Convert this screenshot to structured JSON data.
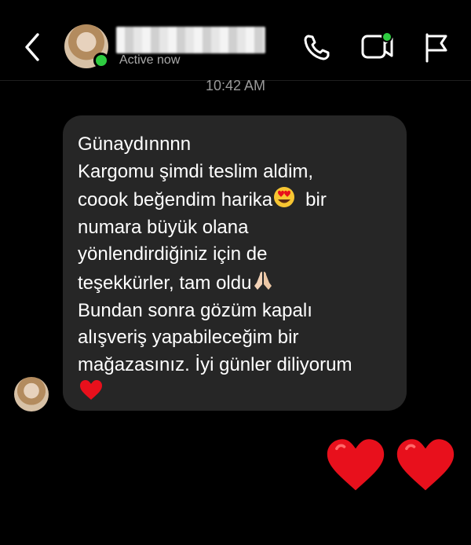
{
  "header": {
    "status": "Active now",
    "icons": [
      "back-chevron-icon",
      "phone-icon",
      "video-icon",
      "flag-icon"
    ]
  },
  "timestamp": "10:42 AM",
  "message": {
    "lines": [
      "Günaydınnnn",
      "Kargomu şimdi teslim aldim,",
      "coook beğendim harika",
      "bir",
      "numara büyük olana",
      "yönlendirdiğiniz için de",
      "teşekkürler, tam oldu",
      "Bundan sonra gözüm kapalı",
      "alışveriş yapabileceğim bir",
      "mağazasınız. İyi günler diliyorum"
    ],
    "emojis": [
      "heart-eyes-emoji",
      "folded-hands-emoji",
      "red-heart-emoji"
    ]
  },
  "reply": {
    "emojis": [
      "red-heart-emoji",
      "red-heart-emoji"
    ]
  },
  "colors": {
    "background": "#000000",
    "bubble": "#262626",
    "online": "#2ecc40",
    "heart": "#e8101c",
    "status_text": "#a9a9a9"
  }
}
